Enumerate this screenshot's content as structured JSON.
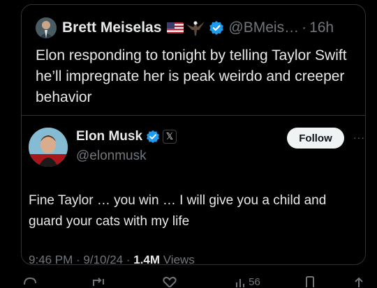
{
  "outer_tweet": {
    "author_name": "Brett Meiselas",
    "handle": "@BMeis…",
    "separator": "·",
    "time": "16h",
    "text": "Elon responding to tonight by telling Taylor Swift he’ll impregnate her is peak weirdo and creeper behavior"
  },
  "quoted_tweet": {
    "author_name": "Elon Musk",
    "affiliate_badge": "𝕏",
    "handle": "@elonmusk",
    "follow_label": "Follow",
    "more_label": "···",
    "text": "Fine Taylor … you win … I will give you a child and guard your cats with my life",
    "timestamp": "9:46 PM · 9/10/24 · ",
    "views_count": "1.4M",
    "views_label": " Views"
  },
  "actions": {
    "likes_count": "56"
  },
  "colors": {
    "background": "#000000",
    "verified_blue": "#1d9bf0",
    "secondary_text": "#71767b"
  }
}
